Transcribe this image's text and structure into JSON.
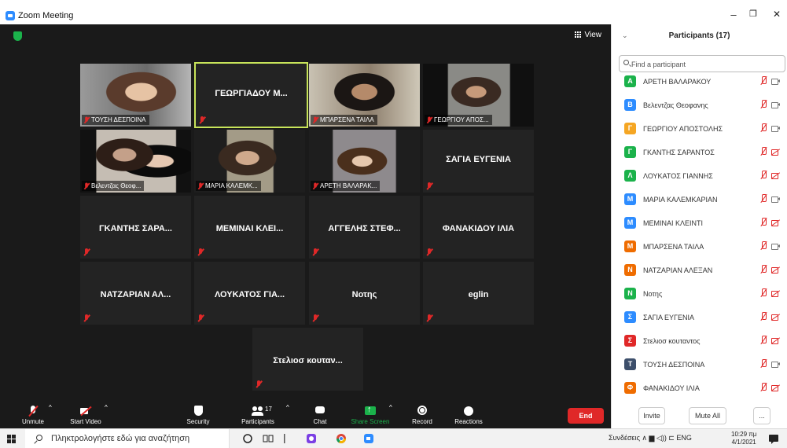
{
  "window": {
    "title": "Zoom Meeting",
    "minimize": "–",
    "restore": "❐",
    "close": "✕"
  },
  "view": {
    "label": "View"
  },
  "tiles": [
    {
      "label": "ΤΟΥΣΗ ΔΕΣΠΟΙΝΑ",
      "has_video": true
    },
    {
      "label": "ΓΕΩΡΓΙΑΔΟΥ Μ...",
      "has_video": false,
      "active": true
    },
    {
      "label": "ΜΠΑΡΣΕΝΑ ΤΑΙΛΑ",
      "has_video": true
    },
    {
      "label": "ΓΕΩΡΓΙΟΥ ΑΠΟΣ...",
      "has_video": true
    },
    {
      "label": "Βελεντζας Θεοφ...",
      "has_video": true
    },
    {
      "label": "ΜΑΡΙΑ ΚΑΛΕΜΚ...",
      "has_video": true
    },
    {
      "label": "ΑΡΕΤΗ ΒΑΛΑΡΑΚ...",
      "has_video": true
    },
    {
      "label": "ΣΑΓΙΑ ΕΥΓΕΝΙΑ",
      "has_video": false
    },
    {
      "label": "ΓΚΑΝΤΗΣ ΣΑΡΑ...",
      "has_video": false
    },
    {
      "label": "ΜΕΜΙΝΑΙ ΚΛΕΙ...",
      "has_video": false
    },
    {
      "label": "ΑΓΓΕΛΗΣ ΣΤΕΦ...",
      "has_video": false
    },
    {
      "label": "ΦΑΝΑΚΙΔΟΥ ΙΛΙΑ",
      "has_video": false
    },
    {
      "label": "ΝΑΤΖΑΡΙΑΝ ΑΛ...",
      "has_video": false
    },
    {
      "label": "ΛΟΥΚΑΤΟΣ ΓΙΑ...",
      "has_video": false
    },
    {
      "label": "Νοτης",
      "has_video": false
    },
    {
      "label": "eglin",
      "has_video": false
    },
    {
      "label": "Στελιοσ κουταν...",
      "has_video": false
    }
  ],
  "toolbar": {
    "unmute": "Unmute",
    "start_video": "Start Video",
    "security": "Security",
    "participants": "Participants",
    "participants_count": "17",
    "chat": "Chat",
    "share_screen": "Share Screen",
    "record": "Record",
    "reactions": "Reactions",
    "end": "End",
    "caret": "^"
  },
  "panel": {
    "title": "Participants (17)",
    "collapse": "⌄",
    "search_placeholder": "Find a participant",
    "participants": [
      {
        "initial": "A",
        "name": "ΑΡΕΤΗ ΒΑΛΑΡΑΚΟΥ",
        "color": "#1bb24b",
        "video": "on"
      },
      {
        "initial": "B",
        "name": "Βελεντζας Θεοφανης",
        "color": "#2d8cff",
        "video": "on"
      },
      {
        "initial": "Γ",
        "name": "ΓΕΩΡΓΙΟΥ ΑΠΟΣΤΟΛΗΣ",
        "color": "#f5a623",
        "video": "on"
      },
      {
        "initial": "Γ",
        "name": "ΓΚΑΝΤΗΣ ΣΑΡΑΝΤΟΣ",
        "color": "#1bb24b",
        "video": "off"
      },
      {
        "initial": "Λ",
        "name": "ΛΟΥΚΑΤΟΣ ΓΙΑΝΝΗΣ",
        "color": "#1bb24b",
        "video": "off"
      },
      {
        "initial": "M",
        "name": "ΜΑΡΙΑ ΚΑΛΕΜΚΑΡΙΑΝ",
        "color": "#2d8cff",
        "video": "on"
      },
      {
        "initial": "M",
        "name": "ΜΕΜΙΝΑΙ ΚΛΕΙΝΤΙ",
        "color": "#2d8cff",
        "video": "off"
      },
      {
        "initial": "M",
        "name": "ΜΠΑΡΣΕΝΑ ΤΑΙΛΑ",
        "color": "#ef6c00",
        "video": "on"
      },
      {
        "initial": "N",
        "name": "ΝΑΤΖΑΡΙΑΝ ΑΛΕΞΑΝ",
        "color": "#ef6c00",
        "video": "off"
      },
      {
        "initial": "N",
        "name": "Νοτης",
        "color": "#1bb24b",
        "video": "off"
      },
      {
        "initial": "Σ",
        "name": "ΣΑΓΙΑ ΕΥΓΕΝΙΑ",
        "color": "#2d8cff",
        "video": "off"
      },
      {
        "initial": "Σ",
        "name": "Στελιοσ κουταντος",
        "color": "#e02828",
        "video": "off"
      },
      {
        "initial": "T",
        "name": "ΤΟΥΣΗ ΔΕΣΠΟΙΝΑ",
        "color": "#3d4f6b",
        "video": "on"
      },
      {
        "initial": "Φ",
        "name": "ΦΑΝΑΚΙΔΟΥ ΙΛΙΑ",
        "color": "#ef6c00",
        "video": "off"
      }
    ],
    "invite": "Invite",
    "mute_all": "Mute All",
    "more": "..."
  },
  "taskbar": {
    "search_placeholder": "Πληκτρολογήστε εδώ για αναζήτηση",
    "tray_text": "Συνδέσεις ∧ ▆ ◁)) ⊏ ENG",
    "time": "10:29 πμ",
    "date": "4/1/2021"
  }
}
